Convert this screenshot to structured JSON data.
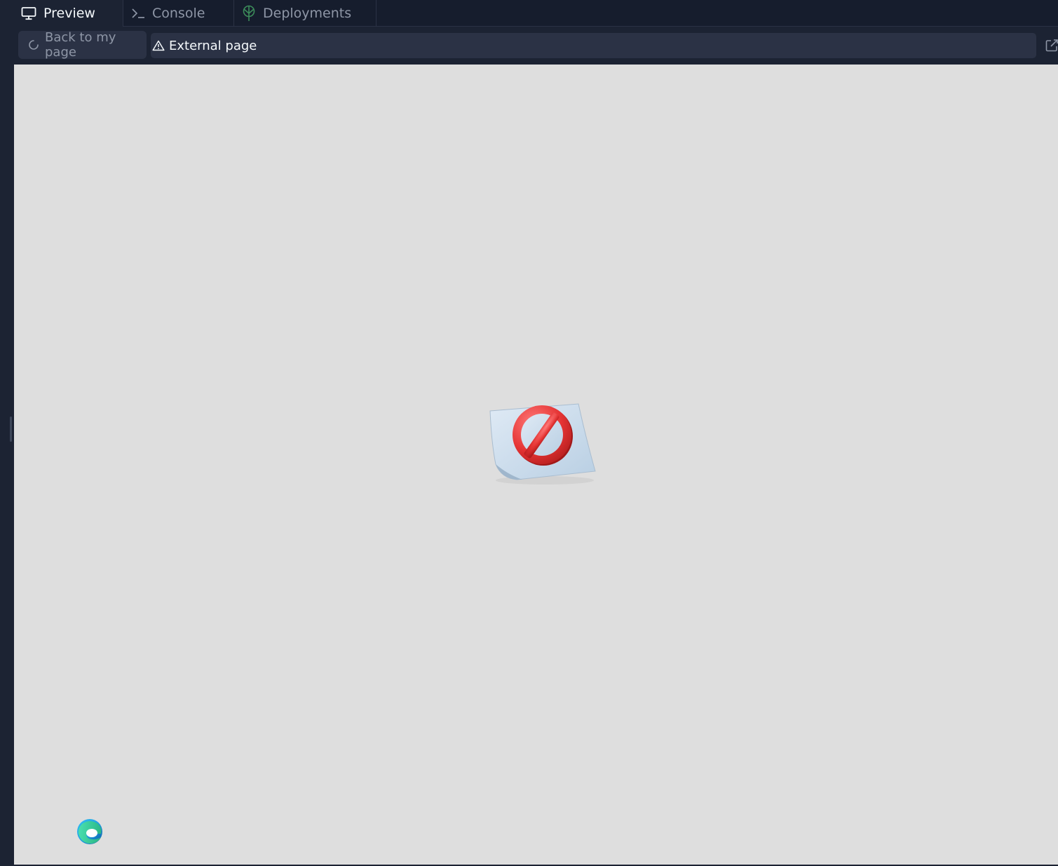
{
  "tabs": [
    {
      "label": "Preview",
      "icon": "monitor-icon",
      "active": true
    },
    {
      "label": "Console",
      "icon": "terminal-icon",
      "active": false
    },
    {
      "label": "Deployments",
      "icon": "deployments-icon",
      "active": false
    }
  ],
  "toolbar": {
    "back_label": "Back to my page",
    "back_icon": "loading-spinner-icon",
    "address_label": "External page",
    "address_icon": "warning-triangle-icon",
    "open_icon": "open-external-icon"
  },
  "viewport": {
    "illustration": "blocked-page-icon",
    "corner_logo": "edge-browser-logo-icon",
    "background": "#dedede"
  },
  "colors": {
    "app_bg": "#1c2333",
    "tabbar_bg": "#161d2d",
    "control_bg": "#2b3245",
    "text_primary": "#f5f9fc",
    "text_muted": "#8e96a6",
    "deploy_accent": "#3c8c5a"
  }
}
